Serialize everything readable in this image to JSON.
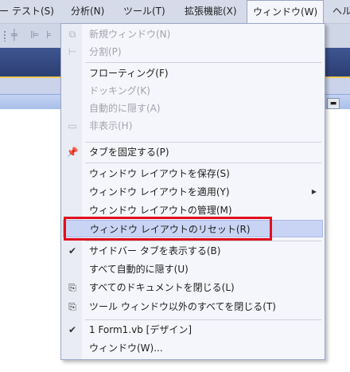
{
  "menubar": {
    "items": [
      "ー",
      "テスト(S)",
      "分析(N)",
      "ツール(T)",
      "拡張機能(X)",
      "ウィンドウ(W)",
      "ヘル"
    ]
  },
  "dropdown": {
    "items": [
      {
        "label": "新規ウィンドウ(N)",
        "icon": "new-window-icon",
        "enabled": false
      },
      {
        "label": "分割(P)",
        "icon": "split-icon",
        "enabled": false
      },
      {
        "label": "フローティング(F)",
        "icon": "",
        "enabled": true
      },
      {
        "label": "ドッキング(K)",
        "icon": "",
        "enabled": false
      },
      {
        "label": "自動的に隠す(A)",
        "icon": "",
        "enabled": false
      },
      {
        "label": "非表示(H)",
        "icon": "hide-icon",
        "enabled": false
      },
      {
        "label": "タブを固定する(P)",
        "icon": "pin-icon",
        "enabled": true
      },
      {
        "label": "ウィンドウ レイアウトを保存(S)",
        "icon": "",
        "enabled": true
      },
      {
        "label": "ウィンドウ レイアウトを適用(Y)",
        "icon": "",
        "enabled": true,
        "submenu": true
      },
      {
        "label": "ウィンドウ レイアウトの管理(M)",
        "icon": "",
        "enabled": true
      },
      {
        "label": "ウィンドウ レイアウトのリセット(R)",
        "icon": "",
        "enabled": true,
        "highlighted": true
      },
      {
        "label": "サイドバー タブを表示する(B)",
        "icon": "check-icon",
        "enabled": true
      },
      {
        "label": "すべて自動的に隠す(U)",
        "icon": "",
        "enabled": true
      },
      {
        "label": "すべてのドキュメントを閉じる(L)",
        "icon": "close-all-documents-icon",
        "enabled": true
      },
      {
        "label": "ツール ウィンドウ以外のすべてを閉じる(T)",
        "icon": "close-all-but-tool-windows-icon",
        "enabled": true
      },
      {
        "label": "1 Form1.vb [デザイン]",
        "icon": "check-icon",
        "enabled": true
      },
      {
        "label": "ウィンドウ(W)...",
        "icon": "",
        "enabled": true
      }
    ]
  },
  "colors": {
    "highlight": "#c9d4f4",
    "annotation_box": "#e0101c",
    "title_band": "#34497f"
  }
}
